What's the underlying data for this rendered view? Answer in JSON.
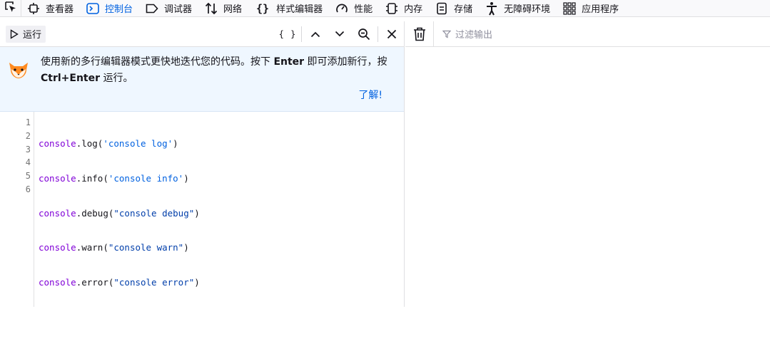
{
  "tabs": [
    {
      "label": "查看器",
      "icon": "inspector-icon",
      "selected": false
    },
    {
      "label": "控制台",
      "icon": "console-icon",
      "selected": true
    },
    {
      "label": "调试器",
      "icon": "debugger-icon",
      "selected": false
    },
    {
      "label": "网络",
      "icon": "network-icon",
      "selected": false
    },
    {
      "label": "样式编辑器",
      "icon": "style-editor-icon",
      "selected": false
    },
    {
      "label": "性能",
      "icon": "performance-icon",
      "selected": false
    },
    {
      "label": "内存",
      "icon": "memory-icon",
      "selected": false
    },
    {
      "label": "存储",
      "icon": "storage-icon",
      "selected": false
    },
    {
      "label": "无障碍环境",
      "icon": "accessibility-icon",
      "selected": false
    },
    {
      "label": "应用程序",
      "icon": "application-icon",
      "selected": false
    }
  ],
  "input_toolbar": {
    "run_label": "运行",
    "pretty_print_label": "{ }"
  },
  "notice": {
    "text_part1": "使用新的多行编辑器模式更快地迭代您的代码。按下 ",
    "key_enter": "Enter",
    "text_part2": " 即可添加新行，按 ",
    "key_ctrl_enter": "Ctrl+Enter",
    "text_part3": " 运行。",
    "link_label": "了解!"
  },
  "editor": {
    "line_numbers": [
      "1",
      "2",
      "3",
      "4",
      "5",
      "6"
    ],
    "lines": [
      {
        "obj": "console",
        "method": ".log(",
        "str": "'console log'",
        "close": ")"
      },
      {
        "obj": "console",
        "method": ".info(",
        "str": "'console info'",
        "close": ")"
      },
      {
        "obj": "console",
        "method": ".debug(",
        "str": "\"console debug\"",
        "close": ")"
      },
      {
        "obj": "console",
        "method": ".warn(",
        "str": "\"console warn\"",
        "close": ")"
      },
      {
        "obj": "console",
        "method": ".error(",
        "str": "\"console error\"",
        "close": ")"
      }
    ]
  },
  "output_toolbar": {
    "filter_placeholder": "过滤输出"
  },
  "colors": {
    "accent": "#0061e0",
    "notice_bg": "#eff7ff",
    "code_object": "#8000d7",
    "code_string": "#0061e0"
  }
}
